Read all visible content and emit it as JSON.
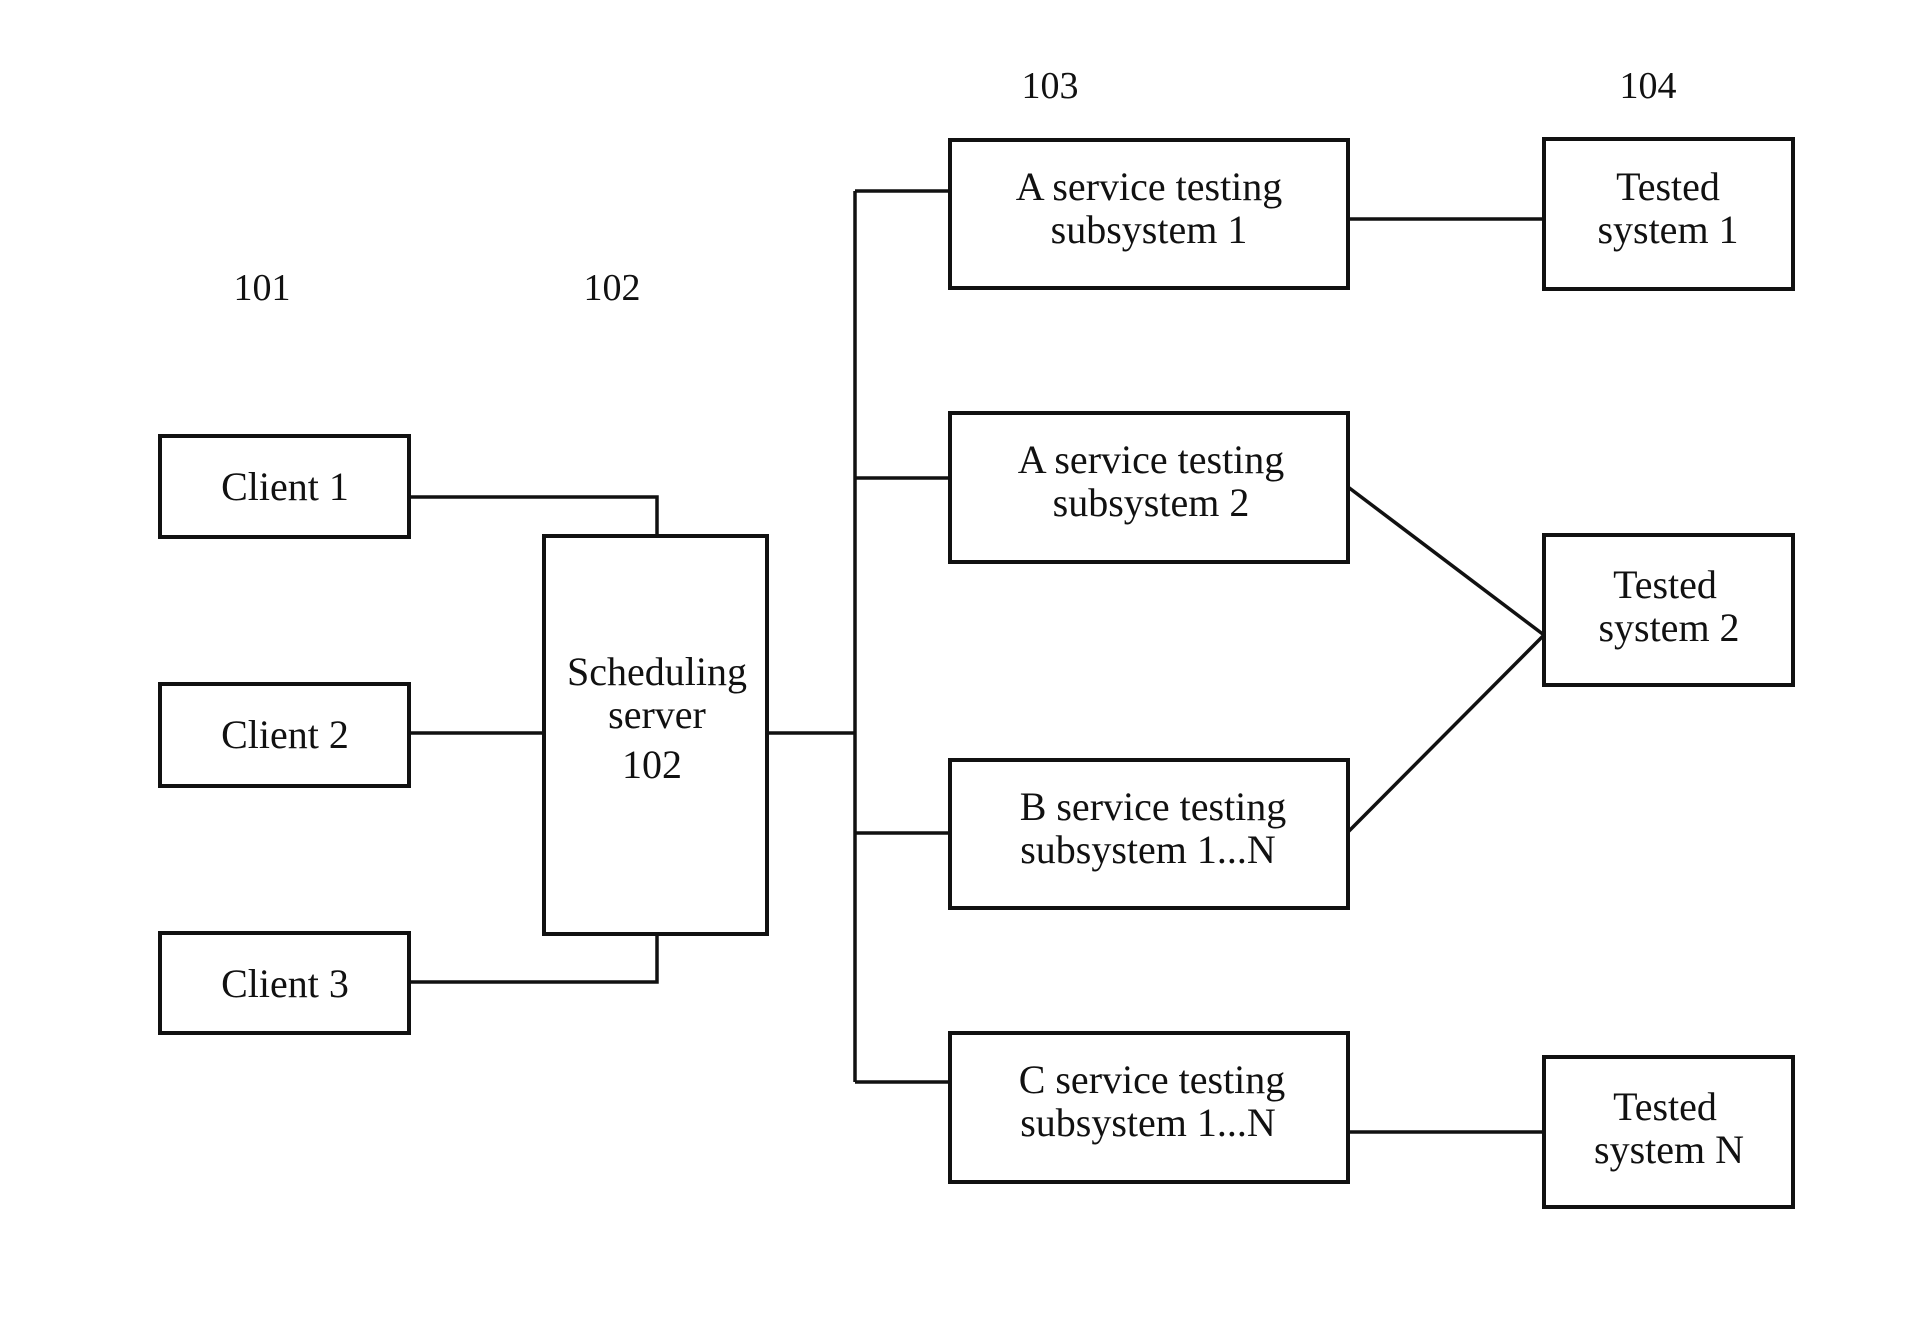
{
  "figure": {
    "reference_labels": {
      "clients": "101",
      "scheduling": "102",
      "subsystems": "103",
      "tested_systems": "104"
    },
    "clients": [
      {
        "id": "client-1",
        "label": "Client 1"
      },
      {
        "id": "client-2",
        "label": "Client 2"
      },
      {
        "id": "client-3",
        "label": "Client 3"
      }
    ],
    "scheduling_server": {
      "lines": [
        "Scheduling",
        "server",
        "102"
      ]
    },
    "subsystems": [
      {
        "id": "a-subsystem-1",
        "lines": [
          "A service testing",
          "subsystem 1"
        ]
      },
      {
        "id": "a-subsystem-2",
        "lines": [
          "A service testing",
          "subsystem 2"
        ]
      },
      {
        "id": "b-subsystem",
        "lines": [
          "B service testing",
          "subsystem 1...N"
        ]
      },
      {
        "id": "c-subsystem",
        "lines": [
          "C service testing",
          "subsystem 1...N"
        ]
      }
    ],
    "tested_systems": [
      {
        "id": "tested-system-1",
        "lines": [
          "Tested",
          "system 1"
        ]
      },
      {
        "id": "tested-system-2",
        "lines": [
          "Tested",
          "system 2"
        ]
      },
      {
        "id": "tested-system-n",
        "lines": [
          "Tested",
          "system N"
        ]
      }
    ],
    "connections": [
      [
        "client-1",
        "scheduling-server"
      ],
      [
        "client-2",
        "scheduling-server"
      ],
      [
        "client-3",
        "scheduling-server"
      ],
      [
        "scheduling-server",
        "a-subsystem-1"
      ],
      [
        "scheduling-server",
        "a-subsystem-2"
      ],
      [
        "scheduling-server",
        "b-subsystem"
      ],
      [
        "scheduling-server",
        "c-subsystem"
      ],
      [
        "a-subsystem-1",
        "tested-system-1"
      ],
      [
        "a-subsystem-2",
        "tested-system-2"
      ],
      [
        "b-subsystem",
        "tested-system-2"
      ],
      [
        "c-subsystem",
        "tested-system-n"
      ]
    ]
  }
}
